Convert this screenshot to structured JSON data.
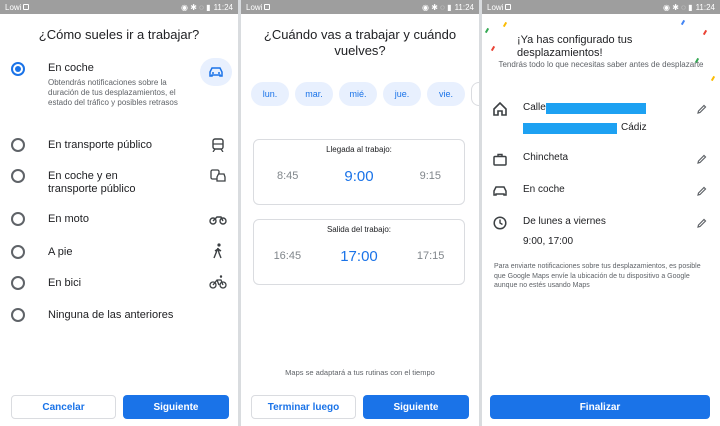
{
  "status": {
    "carrier": "Lowi",
    "time": "11:24"
  },
  "screen1": {
    "title": "¿Cómo sueles ir a trabajar?",
    "options": [
      {
        "label": "En coche",
        "description": "Obtendrás notificaciones sobre la duración de tus desplazamientos, el estado del tráfico y posibles retrasos",
        "icon": "car-icon",
        "selected": true
      },
      {
        "label": "En transporte público",
        "icon": "train-icon",
        "selected": false
      },
      {
        "label": "En coche y en transporte público",
        "icon": "car-transit-icon",
        "selected": false
      },
      {
        "label": "En moto",
        "icon": "motorcycle-icon",
        "selected": false
      },
      {
        "label": "A pie",
        "icon": "walk-icon",
        "selected": false
      },
      {
        "label": "En bici",
        "icon": "bike-icon",
        "selected": false
      },
      {
        "label": "Ninguna de las anteriores",
        "icon": "",
        "selected": false
      }
    ],
    "cancel_label": "Cancelar",
    "next_label": "Siguiente"
  },
  "screen2": {
    "title": "¿Cuándo vas a trabajar y cuándo vuelves?",
    "days": [
      "lun.",
      "mar.",
      "mié.",
      "jue.",
      "vie."
    ],
    "arrival": {
      "title": "Llegada al trabajo:",
      "prev": "8:45",
      "selected": "9:00",
      "next": "9:15"
    },
    "departure": {
      "title": "Salida del trabajo:",
      "prev": "16:45",
      "selected": "17:00",
      "next": "17:15"
    },
    "note": "Maps se adaptará a tus rutinas con el tiempo",
    "later_label": "Terminar luego",
    "next_label": "Siguiente"
  },
  "screen3": {
    "title": "¡Ya has configurado tus desplazamientos!",
    "subtitle": "Tendrás todo lo que necesitas saber antes de desplazarte",
    "home": {
      "line1": "Calle",
      "line2": "Cádiz"
    },
    "work": {
      "label": "Chincheta"
    },
    "mode": {
      "label": "En coche"
    },
    "schedule": {
      "days": "De lunes a viernes",
      "hours": "9:00, 17:00"
    },
    "note": "Para enviarte notificaciones sobre tus desplazamientos, es posible que Google Maps envíe la ubicación de tu dispositivo a Google aunque no estés usando Maps",
    "finish_label": "Finalizar"
  },
  "colors": {
    "accent": "#1a73e8",
    "redaction": "#1da1f2",
    "chip_bg": "#e8f0fe"
  }
}
